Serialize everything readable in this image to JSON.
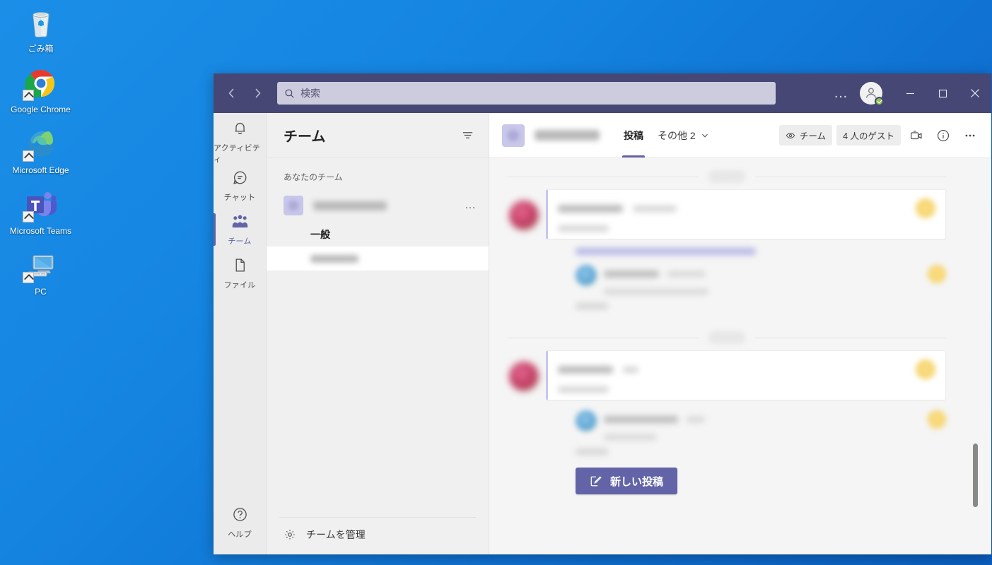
{
  "desktop": {
    "icons": [
      {
        "id": "recycle-bin",
        "label": "ごみ箱",
        "shortcut": false
      },
      {
        "id": "google-chrome",
        "label": "Google Chrome",
        "shortcut": true
      },
      {
        "id": "microsoft-edge",
        "label": "Microsoft Edge",
        "shortcut": true
      },
      {
        "id": "microsoft-teams",
        "label": "Microsoft Teams",
        "shortcut": true
      },
      {
        "id": "pc",
        "label": "PC",
        "shortcut": true
      }
    ]
  },
  "window": {
    "titlebar": {
      "back_icon": "chevron-left-icon",
      "forward_icon": "chevron-right-icon",
      "search_placeholder": "検索",
      "search_value": "",
      "search_icon": "search-icon",
      "more_label": "…",
      "avatar_icon": "person-avatar-icon",
      "presence": "available",
      "minimize_label": "—",
      "maximize_label": "□",
      "close_label": "✕",
      "accent_color": "#464775",
      "search_bg": "#cdccdf"
    },
    "rail": {
      "items": [
        {
          "id": "activity",
          "label": "アクティビティ",
          "icon": "bell-icon",
          "active": false
        },
        {
          "id": "chat",
          "label": "チャット",
          "icon": "chat-bubble-icon",
          "active": false
        },
        {
          "id": "teams",
          "label": "チーム",
          "icon": "people-icon",
          "active": true
        },
        {
          "id": "files",
          "label": "ファイル",
          "icon": "file-icon",
          "active": false
        }
      ],
      "help": {
        "id": "help",
        "label": "ヘルプ",
        "icon": "question-circle-icon"
      }
    },
    "teams_panel": {
      "title": "チーム",
      "filter_icon": "filter-icon",
      "section_label": "あなたのチーム",
      "team": {
        "name_redacted": true,
        "name": "",
        "avatar_icon": "team-avatar-icon",
        "more_label": "…"
      },
      "channels": [
        {
          "id": "general",
          "label": "一般",
          "selected": false,
          "redacted": false
        },
        {
          "id": "channel-redacted",
          "label": "",
          "selected": true,
          "redacted": true
        }
      ],
      "manage_team": {
        "label": "チームを管理",
        "icon": "gear-icon"
      }
    },
    "channel": {
      "header": {
        "avatar_icon": "channel-avatar-icon",
        "name_redacted": true,
        "name": "",
        "tabs": [
          {
            "id": "posts",
            "label": "投稿",
            "active": true
          },
          {
            "id": "more",
            "label": "その他 2",
            "active": false,
            "caret_icon": "chevron-down-icon"
          }
        ],
        "pills": [
          {
            "id": "team-visibility",
            "label": "チーム",
            "icon": "eye-icon"
          },
          {
            "id": "guest-count",
            "label": "4 人のゲスト",
            "icon": ""
          }
        ],
        "icons": [
          {
            "id": "meet-now",
            "name": "video-camera-icon"
          },
          {
            "id": "channel-info",
            "name": "info-circle-icon"
          },
          {
            "id": "channel-more",
            "name": "ellipsis-icon"
          }
        ]
      },
      "posts": [
        {
          "id": "post-1",
          "day_chip_redacted": true,
          "author_redacted": true,
          "timestamp_redacted": true,
          "body_redacted": true,
          "has_reaction": true,
          "reaction_color": "#f6d56d",
          "avatar_color": "#c0395f",
          "link_line_redacted": true,
          "reply": {
            "author_redacted": true,
            "body_redacted": true,
            "avatar_color": "#5fa6d6",
            "has_reaction": true
          },
          "reply_bar_redacted": true
        },
        {
          "id": "post-2",
          "day_chip_redacted": true,
          "author_redacted": true,
          "timestamp_redacted": true,
          "body_redacted": true,
          "has_reaction": true,
          "reaction_color": "#f6d56d",
          "avatar_color": "#c0395f",
          "link_line_redacted": false,
          "reply": {
            "author_redacted": true,
            "body_redacted": true,
            "avatar_color": "#5fa6d6",
            "has_reaction": true
          },
          "reply_bar_redacted": true
        }
      ],
      "new_post_button": {
        "label": "新しい投稿",
        "icon": "compose-icon",
        "color": "#6264a7"
      },
      "scrollbar": {
        "thumb_top_pct": 60,
        "thumb_height_pct": 15
      }
    }
  }
}
